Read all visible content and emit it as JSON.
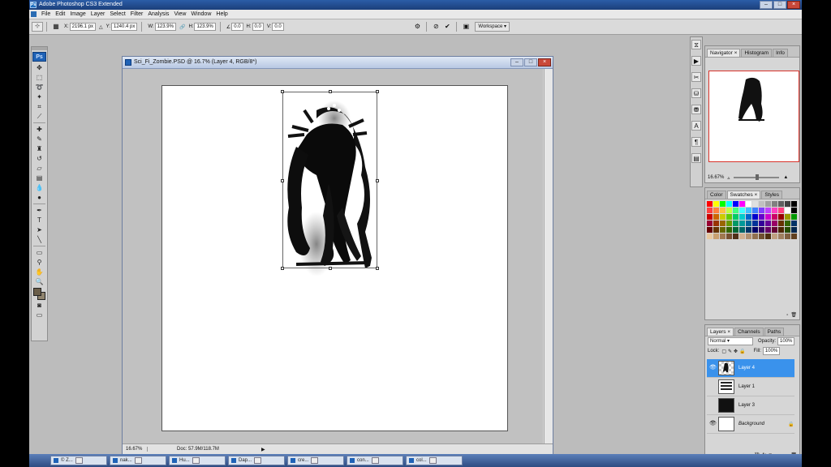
{
  "window": {
    "title": "Adobe Photoshop CS3 Extended"
  },
  "menu": [
    "File",
    "Edit",
    "Image",
    "Layer",
    "Select",
    "Filter",
    "Analysis",
    "View",
    "Window",
    "Help"
  ],
  "options": {
    "x_label": "X:",
    "x_value": "2196.1 px",
    "y_label": "Y:",
    "y_value": "1240.4 px",
    "w_label": "W:",
    "w_value": "123.9%",
    "h_label": "H:",
    "h_value": "123.9%",
    "rot_value": "0.0",
    "hskew_label": "H:",
    "hskew_value": "0.0",
    "vskew_label": "V:",
    "vskew_value": "0.0",
    "workspace_label": "Workspace"
  },
  "toolbox": {
    "logo": "Ps"
  },
  "document": {
    "title": "Sci_Fi_Zombie.PSD @ 16.7% (Layer 4, RGB/8*)",
    "zoom": "16.67%",
    "doc_info": "Doc: 57.9M/118.7M"
  },
  "navigator": {
    "tabs": [
      "Navigator",
      "Histogram",
      "Info"
    ],
    "zoom": "16.67%"
  },
  "color_panel": {
    "tabs": [
      "Color",
      "Swatches",
      "Styles"
    ],
    "swatches": [
      "#ff0000",
      "#ffff00",
      "#00ff00",
      "#00ffff",
      "#0000ff",
      "#ff00ff",
      "#ffffff",
      "#e0e0e0",
      "#c0c0c0",
      "#a0a0a0",
      "#808080",
      "#606060",
      "#404040",
      "#000000",
      "#ff4040",
      "#ff8040",
      "#ffc040",
      "#c0ff40",
      "#40ff80",
      "#40ffff",
      "#40c0ff",
      "#4080ff",
      "#8040ff",
      "#c040ff",
      "#ff40c0",
      "#ff4080",
      "#ffffff",
      "#000000",
      "#cc0000",
      "#cc6600",
      "#cccc00",
      "#66cc00",
      "#00cc66",
      "#00cccc",
      "#0066cc",
      "#0000cc",
      "#6600cc",
      "#cc00cc",
      "#cc0066",
      "#990000",
      "#999900",
      "#009900",
      "#990033",
      "#993300",
      "#996600",
      "#669900",
      "#009966",
      "#009999",
      "#006699",
      "#003399",
      "#330099",
      "#660099",
      "#990066",
      "#663300",
      "#336600",
      "#003366",
      "#660000",
      "#663300",
      "#666600",
      "#336600",
      "#006633",
      "#006666",
      "#003366",
      "#000066",
      "#330066",
      "#660066",
      "#660033",
      "#4d2600",
      "#264d00",
      "#00264d",
      "#e8c9a0",
      "#c9a070",
      "#a07850",
      "#785030",
      "#503018",
      "#d0b090",
      "#b09070",
      "#907050",
      "#705030",
      "#503010",
      "#c0a080",
      "#a08060",
      "#806040",
      "#604020"
    ]
  },
  "layers": {
    "tabs": [
      "Layers",
      "Channels",
      "Paths"
    ],
    "blend_mode": "Normal",
    "opacity_label": "Opacity:",
    "opacity": "100%",
    "lock_label": "Lock:",
    "fill_label": "Fill:",
    "fill": "100%",
    "items": [
      {
        "name": "Layer 4",
        "visible": true,
        "selected": true
      },
      {
        "name": "Layer 1",
        "visible": false,
        "selected": false
      },
      {
        "name": "Layer 3",
        "visible": false,
        "selected": false
      },
      {
        "name": "Background",
        "visible": true,
        "selected": false
      }
    ]
  },
  "taskbar": {
    "items": [
      "© Z...",
      "nak...",
      "Hu...",
      "Dap...",
      "cre...",
      "con...",
      "col..."
    ]
  }
}
